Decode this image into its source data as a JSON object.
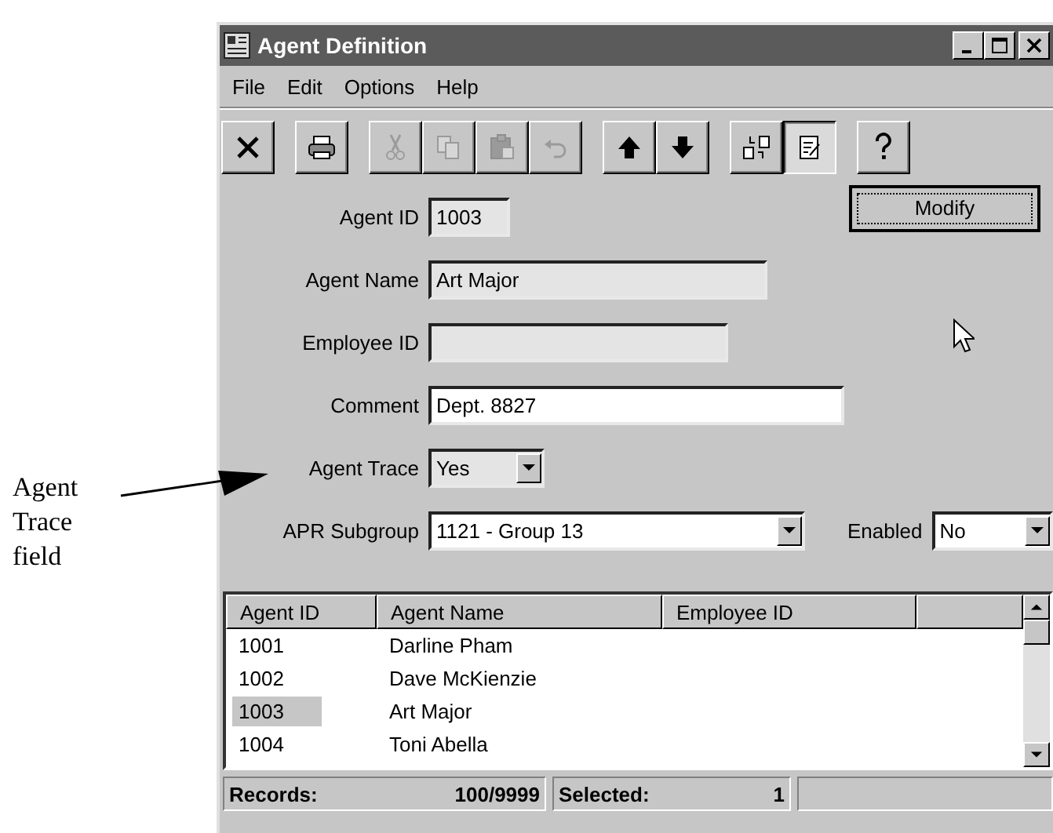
{
  "callout": {
    "text": "Agent Trace field"
  },
  "window": {
    "title": "Agent Definition"
  },
  "menu": [
    "File",
    "Edit",
    "Options",
    "Help"
  ],
  "toolbar": [
    {
      "disabled": false,
      "pressed": false,
      "separator_before": false
    },
    {
      "disabled": false,
      "pressed": false,
      "separator_before": true
    },
    {
      "disabled": true,
      "pressed": false,
      "separator_before": true
    },
    {
      "disabled": true,
      "pressed": false,
      "separator_before": false
    },
    {
      "disabled": true,
      "pressed": false,
      "separator_before": false
    },
    {
      "disabled": true,
      "pressed": false,
      "separator_before": false
    },
    {
      "disabled": false,
      "pressed": false,
      "separator_before": true
    },
    {
      "disabled": false,
      "pressed": false,
      "separator_before": false
    },
    {
      "disabled": false,
      "pressed": false,
      "separator_before": true
    },
    {
      "disabled": false,
      "pressed": true,
      "separator_before": false
    },
    {
      "disabled": false,
      "pressed": false,
      "separator_before": true
    }
  ],
  "modify_button": "Modify",
  "fields": [
    {
      "label": "Agent ID",
      "value": "1003",
      "kind": "text",
      "readonly": true
    },
    {
      "label": "Agent Name",
      "value": "Art Major",
      "kind": "text",
      "readonly": true
    },
    {
      "label": "Employee ID",
      "kind": "text",
      "readonly": true
    },
    {
      "label": "Comment",
      "value": "Dept. 8827",
      "kind": "text",
      "readonly": false
    },
    {
      "label": "Agent Trace",
      "value": "Yes",
      "kind": "combo",
      "readonly": true
    },
    {
      "label": "APR Subgroup",
      "value": "1121 - Group 13",
      "kind": "combo",
      "readonly": false
    }
  ],
  "enabled_field": {
    "label": "Enabled",
    "value": "No"
  },
  "table": {
    "columns": [
      "Agent ID",
      "Agent Name",
      "Employee ID"
    ],
    "rows": [
      {
        "id": "1001",
        "name": "Darline Pham",
        "selected": false
      },
      {
        "id": "1002",
        "name": "Dave McKienzie",
        "selected": false
      },
      {
        "id": "1003",
        "name": "Art Major",
        "selected": true
      },
      {
        "id": "1004",
        "name": "Toni Abella",
        "selected": false
      }
    ]
  },
  "status_bar": {
    "records_label": "Records:",
    "records": "100/9999",
    "selected_label": "Selected:",
    "selected": "1"
  }
}
